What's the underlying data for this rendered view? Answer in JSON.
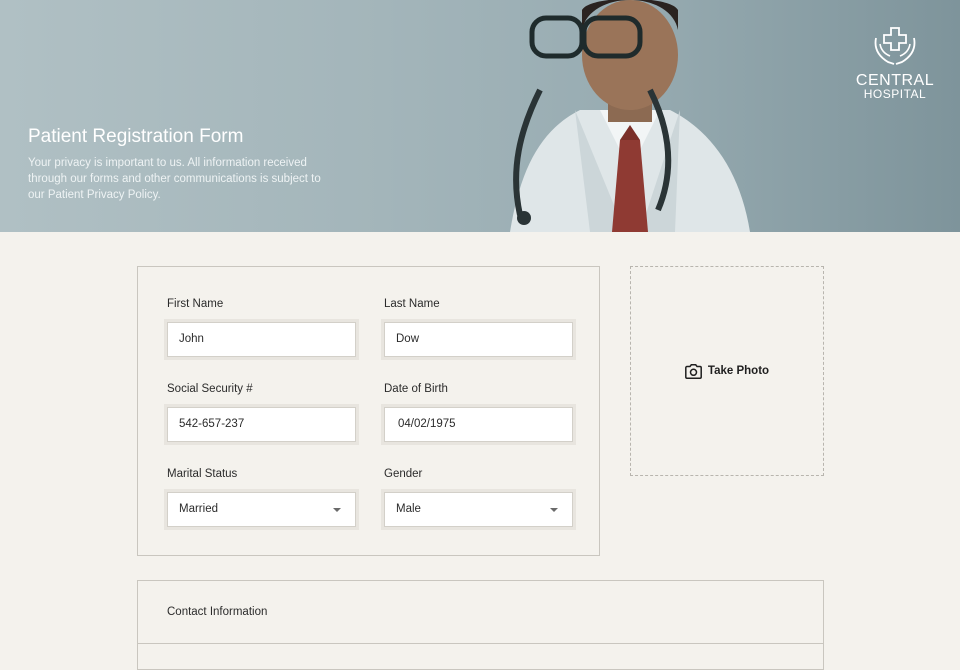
{
  "hero": {
    "title": "Patient Registration Form",
    "subtitle": "Your privacy is important to us. All information received through our forms and other communications is subject to our Patient Privacy Policy.",
    "logo_line1": "CENTRAL",
    "logo_line2": "HOSPITAL",
    "logo_icon": "hands-cross-icon"
  },
  "form": {
    "first_name": {
      "label": "First Name",
      "value": "John"
    },
    "last_name": {
      "label": "Last Name",
      "value": "Dow"
    },
    "ssn": {
      "label": "Social Security #",
      "value": "542-657-237"
    },
    "dob": {
      "label": "Date of Birth",
      "value": "04/02/1975"
    },
    "marital": {
      "label": "Marital Status",
      "value": "Married"
    },
    "gender": {
      "label": "Gender",
      "value": "Male"
    }
  },
  "photo": {
    "label": "Take Photo",
    "icon": "camera-icon"
  },
  "contact": {
    "title": "Contact Information"
  },
  "colors": {
    "background": "#f4f2ed",
    "border": "#c9c6bf",
    "hero": "#9fb2b7"
  }
}
